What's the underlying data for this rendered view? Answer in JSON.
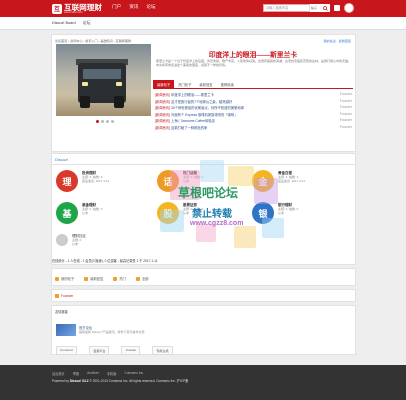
{
  "header": {
    "logo_mark": "互",
    "logo_text": "互联网理财",
    "logo_sub": "www.caifu.com",
    "nav": [
      "门户",
      "资讯",
      "论坛"
    ],
    "search_placeholder": "请输入搜索内容",
    "search_scope": "帖子",
    "brand_color": "#c8161d"
  },
  "subbar": {
    "current": "Discuz! Board",
    "link": "论坛"
  },
  "featured": {
    "breadcrumb": "论坛首页 › 资讯中心 › 新手入门 › 基础知识 › 互联网理财",
    "right_links": "我的关注 · 最新回复",
    "title": "印度洋上的眼泪——斯里兰卡",
    "desc": "斯里兰卡是一个位于印度洋上的岛国，风景秀丽，物产丰富，人民热情好客。这里有美丽的海滩、古老的寺庙和茂密的丛林，是旅行者心中的天堂。本文将带你走进这个美丽的国度，感受不一样的风情。",
    "tabs": [
      "最新帖子",
      "热门帖子",
      "最新回复",
      "推荐阅读"
    ],
    "list": [
      {
        "tag": "[新闻资讯]",
        "title": "印度洋上的眼泪——斯里兰卡",
        "author": "Founder"
      },
      {
        "tag": "[新闻资讯]",
        "title": "这才是旅行者的7个地球仪之最，越来越好",
        "author": "Founder"
      },
      {
        "tag": "[新闻资讯]",
        "title": "30个惊世骇俗的优美景点，你所不知道的美丽地球",
        "author": "Founder"
      },
      {
        "tag": "[新闻资讯]",
        "title": "冷面有个 Express 咖啡机家族带来的「咖啡」",
        "author": "Founder"
      },
      {
        "tag": "[新闻资讯]",
        "title": "上海 | Twosome Coffee体验店",
        "author": "Founder"
      },
      {
        "tag": "[新闻资讯]",
        "title": "这款打破了一种颜色的家",
        "author": "Founder"
      }
    ]
  },
  "forum": {
    "head": "Discuz!",
    "boards": [
      {
        "icon": "理",
        "name": "投资理财",
        "stat": "主题: 6, 帖数: 6",
        "last": "最后发表: 2017-1-11",
        "color": "#d9382d"
      },
      {
        "icon": "话",
        "name": "热门话题",
        "stat": "主题: 0, 帖数: 0",
        "last": "从未",
        "color": "#f09a26"
      },
      {
        "icon": "金",
        "name": "黄金白银",
        "stat": "主题: 3, 帖数: 3",
        "last": "最后发表: 2017-1-11",
        "color": "#f5b522"
      },
      {
        "icon": "险",
        "name": "保险专区",
        "stat": "主题: 0, 帖数: 0",
        "last": "从未",
        "color": "#7b3fa8"
      },
      {
        "icon": "基",
        "name": "基金理财",
        "stat": "主题: 0, 帖数: 0",
        "last": "从未",
        "color": "#1ea54a"
      },
      {
        "icon": "股",
        "name": "股票证券",
        "stat": "主题: 0, 帖数: 0",
        "last": "从未",
        "color": "#f5b522"
      },
      {
        "icon": "银",
        "name": "银行理财",
        "stat": "主题: 0, 帖数: 0",
        "last": "从未",
        "color": "#2f74c8"
      },
      {
        "icon": "",
        "name": "理财社区",
        "stat": "主题: 0",
        "last": "从未",
        "color": "#cccccc"
      }
    ]
  },
  "stats": {
    "text": "在线统计 - 1 人在线 - 1 会员(0 隐身), 0 位游客 - 最高记录是 1 于 2017-1-11"
  },
  "bottom_nav": [
    "我的帖子",
    "最新回复",
    "热门",
    "全部"
  ],
  "online": {
    "user": "Founder"
  },
  "links": {
    "title": "友情链接",
    "site_name": "官方论坛",
    "site_desc": "提供最新 Discuz! 产品新闻、软件下载与技术交流",
    "row": [
      "Comsenz",
      "漫游平台",
      "Yeswan",
      "专用主机"
    ]
  },
  "footer": {
    "links": [
      "站点统计",
      "举报",
      "Archiver",
      "手机版",
      "Comsenz Inc."
    ],
    "powered": "Powered by",
    "product": "Discuz! X3.2",
    "copy": "© 2001-2013 Comsenz Inc. All rights reserved. Comsenz Inc. 沪ICP备"
  },
  "watermark": {
    "line1": "草根吧论坛",
    "line2": "禁止转载",
    "line3": "www.cgzz8.com"
  }
}
